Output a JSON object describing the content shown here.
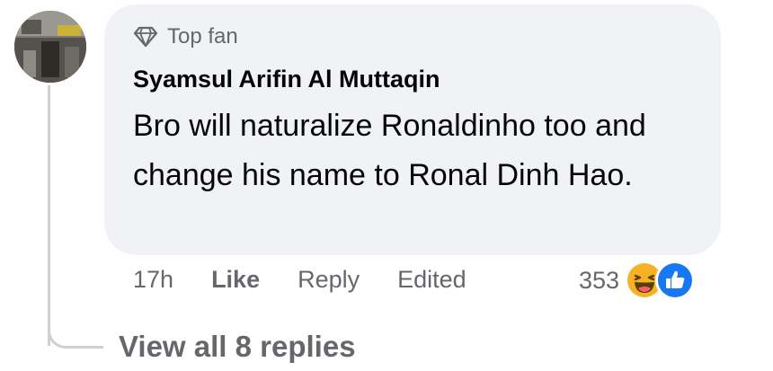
{
  "comment": {
    "badge": "Top fan",
    "badge_icon": "diamond-icon",
    "author": "Syamsul Arifin Al Muttaqin",
    "text": "Bro will naturalize Ronaldinho too and change his name to Ronal Dinh Hao."
  },
  "actions": {
    "time": "17h",
    "like_label": "Like",
    "reply_label": "Reply",
    "edited_label": "Edited"
  },
  "reactions": {
    "count": "353",
    "icons": [
      "haha-icon",
      "like-icon"
    ]
  },
  "replies": {
    "view_all_label": "View all 8 replies"
  },
  "colors": {
    "bubble": "#f0f2f5",
    "secondary_text": "#65676b",
    "primary_text": "#050505",
    "like_blue": "#1877f2",
    "haha_yellow": "#f7b125"
  }
}
